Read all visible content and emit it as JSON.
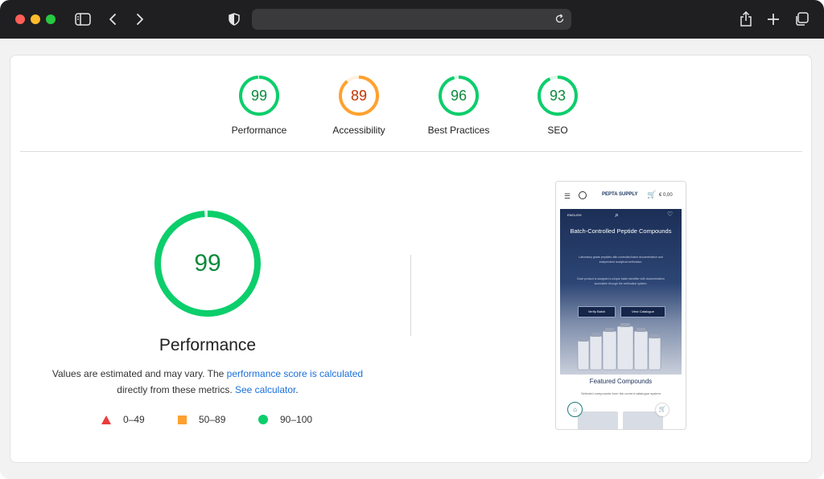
{
  "browser": {
    "address_value": ""
  },
  "categories": [
    {
      "score": "99",
      "label": "Performance",
      "color": "#0cce6b",
      "text_color": "#0c8a3c",
      "fraction": 0.99
    },
    {
      "score": "89",
      "label": "Accessibility",
      "color": "#ffa12e",
      "text_color": "#c33300",
      "fraction": 0.89
    },
    {
      "score": "96",
      "label": "Best Practices",
      "color": "#0cce6b",
      "text_color": "#0c8a3c",
      "fraction": 0.96
    },
    {
      "score": "93",
      "label": "SEO",
      "color": "#0cce6b",
      "text_color": "#0c8a3c",
      "fraction": 0.93
    }
  ],
  "performance": {
    "score": "99",
    "fraction": 0.99,
    "title": "Performance",
    "desc_prefix": "Values are estimated and may vary. The ",
    "desc_link": "performance score is calculated",
    "desc_middle": " directly from these metrics. ",
    "desc_link2": "See calculator",
    "desc_suffix": "."
  },
  "legend": [
    {
      "range": "0–49",
      "shape": "triangle",
      "color": "#eb3b3b"
    },
    {
      "range": "50–89",
      "shape": "square",
      "color": "#ffa12e"
    },
    {
      "range": "90–100",
      "shape": "circle",
      "color": "#0cce6b"
    }
  ],
  "preview": {
    "brand": "PEPTA SUPPLY",
    "cart_price": "€ 0,00",
    "lang": "ENGLISH",
    "hero_title": "Batch-Controlled Peptide Compounds",
    "hero_p1": "Laboratory grade peptides with controlled batch documentation and independent analytical verification.",
    "hero_p2": "Each product is assigned a unique batch identifier with documentation accessible through the verification system.",
    "btn_verify": "Verify Batch",
    "btn_catalogue": "View Catalogue",
    "featured_title": "Featured Compounds",
    "featured_sub": "Selected compounds from the current catalogue system"
  }
}
